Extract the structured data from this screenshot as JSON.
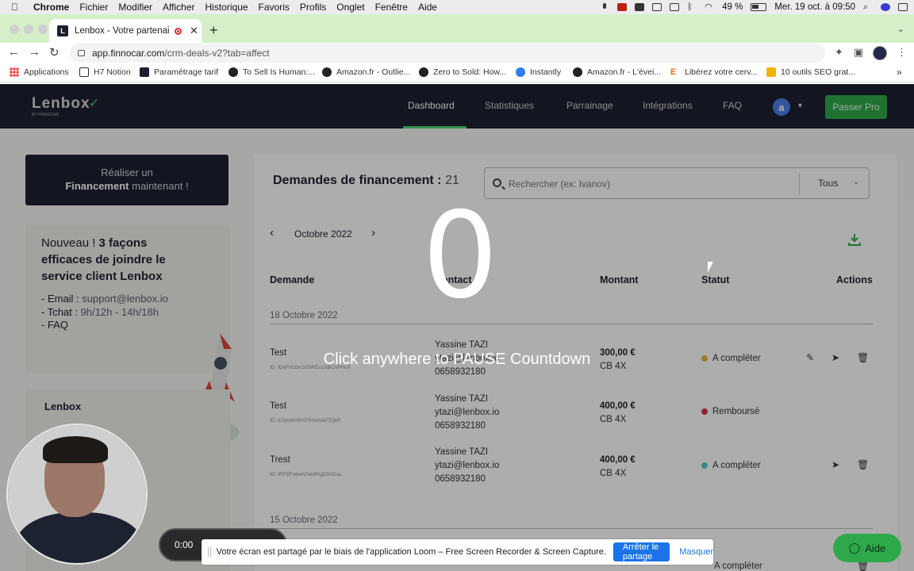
{
  "menubar": {
    "app_name": "Chrome",
    "items": [
      "Fichier",
      "Modifier",
      "Afficher",
      "Historique",
      "Favoris",
      "Profils",
      "Onglet",
      "Fenêtre",
      "Aide"
    ],
    "battery": "49 %",
    "datetime": "Mer. 19 oct. à 09:50"
  },
  "browser": {
    "tab_title": "Lenbox - Votre partenaire",
    "tab_favicon_letter": "L",
    "url_host": "app.finnocar.com",
    "url_path": "/crm-deals-v2?tab=affect",
    "bookmarks": [
      {
        "label": "Applications",
        "icon": "apps-grid-icon"
      },
      {
        "label": "H7 Notion",
        "icon": "notion-icon"
      },
      {
        "label": "Paramétrage tarif",
        "icon": "lenbox-icon"
      },
      {
        "label": "To Sell Is Human:...",
        "icon": "github-icon"
      },
      {
        "label": "Amazon.fr - Outlie...",
        "icon": "github-icon"
      },
      {
        "label": "Zero to Sold: How...",
        "icon": "github-icon"
      },
      {
        "label": "Instantly",
        "icon": "instantly-icon"
      },
      {
        "label": "Amazon.fr - L'évei...",
        "icon": "github-icon"
      },
      {
        "label": "Libérez votre cerv...",
        "icon": "e-icon"
      },
      {
        "label": "10 outils SEO grat...",
        "icon": "bolt-icon"
      }
    ]
  },
  "app": {
    "logo_text": "Lenbox",
    "logo_sub": "BY FINNOCAR",
    "nav": [
      "Dashboard",
      "Statistiques",
      "Parrainage",
      "Intégrations",
      "FAQ"
    ],
    "avatar_letter": "a",
    "cta_label": "Passer Pro",
    "sidebar_cta_line1": "Réaliser un",
    "sidebar_cta_bold": "Financement",
    "sidebar_cta_rest": "maintenant !",
    "news_prefix": "Nouveau ! ",
    "news_bold": "3 façons efficaces de joindre le service client Lenbox",
    "news_email_label": "- Email : ",
    "news_email": "support@lenbox.io",
    "news_chat_label": "- Tchat : ",
    "news_chat": "9h/12h - 14h/18h",
    "news_faq": "- FAQ",
    "sidebar2_name": "Lenbox",
    "main_title": "Demandes de financement :",
    "main_count": "21",
    "search_placeholder": "Rechercher (ex: Ivanov)",
    "filter_value": "Tous",
    "month": "Octobre 2022",
    "prev_icon": "‹",
    "next_icon": "›",
    "columns": {
      "demande": "Demande",
      "contact": "Contact",
      "montant": "Montant",
      "statut": "Statut",
      "actions": "Actions"
    },
    "date_groups": [
      "18 Octobre 2022",
      "15 Octobre 2022"
    ],
    "rows": [
      {
        "demande": "Test",
        "id": "ID: IDxFnCbn1sGiREuLhBCnPHcX",
        "contact_name": "Yassine TAZI",
        "contact_email": "ytazi@lenbox.io",
        "contact_phone": "0658932180",
        "amount": "300,00 €",
        "plan": "CB 4X",
        "status": "A compléter",
        "status_color": "#e2b93b"
      },
      {
        "demande": "Test",
        "id": "ID: b7pIztlrtWYf7IHzmxbTEjbR",
        "contact_name": "Yassine TAZI",
        "contact_email": "ytazi@lenbox.io",
        "contact_phone": "0658932180",
        "amount": "400,00 €",
        "plan": "CB 4X",
        "status": "Remboursé",
        "status_color": "#d9344a"
      },
      {
        "demande": "Trest",
        "id": "ID: IRFEFs6wh7etdtRgD5hDuu",
        "contact_name": "Yassine TAZI",
        "contact_email": "ytazi@lenbox.io",
        "contact_phone": "0658932180",
        "amount": "400,00 €",
        "plan": "CB 4X",
        "status": "A compléter",
        "status_color": "#4fc9c9"
      }
    ],
    "last_row_status": "A compléter"
  },
  "loom": {
    "countdown": "0",
    "pause_text": "Click anywhere to PAUSE Countdown",
    "timer": "0:00",
    "share_message": "Votre écran est partagé par le biais de l'application Loom – Free Screen Recorder & Screen Capture.",
    "stop_label": "Arrêter le partage",
    "hide_label": "Masquer",
    "help_label": "Aide"
  }
}
